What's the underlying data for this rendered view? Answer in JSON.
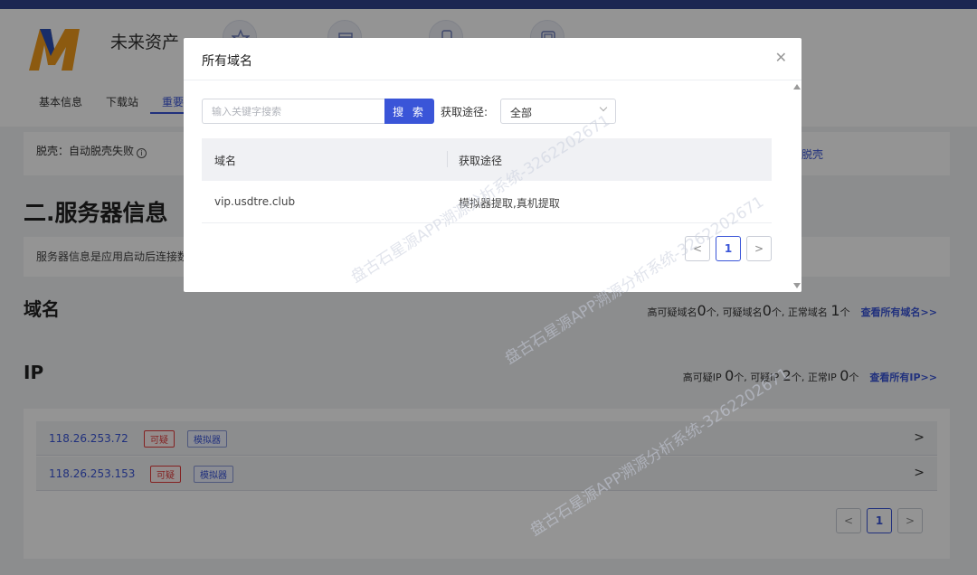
{
  "header": {
    "app_name": "未来资产",
    "tabs": [
      "基本信息",
      "下载站",
      "重要"
    ]
  },
  "shelling": {
    "label": "脱壳：自动脱壳失败",
    "info_glyph": "i",
    "action_label": "脱壳"
  },
  "server": {
    "section_title": "二.服务器信息",
    "description": "服务器信息是应用启动后连接数"
  },
  "domains": {
    "title": "域名",
    "high_label": "高可疑域名",
    "high_count": "0",
    "mid_label": "个, 可疑域名",
    "mid_count": "0",
    "normal_label": "个, 正常域名 ",
    "normal_count": "1",
    "unit": "个",
    "view_all": "查看所有域名>>"
  },
  "ips": {
    "title": "IP",
    "high_label": "高可疑IP ",
    "high_count": "0",
    "mid_label": "个, 可疑IP ",
    "mid_count": "2",
    "normal_label": "个, 正常IP ",
    "normal_count": "0",
    "unit": "个",
    "view_all": "查看所有IP>>",
    "rows": [
      {
        "address": "118.26.253.72",
        "tag_suspicious": "可疑",
        "tag_emulator": "模拟器"
      },
      {
        "address": "118.26.253.153",
        "tag_suspicious": "可疑",
        "tag_emulator": "模拟器"
      }
    ],
    "page": "1"
  },
  "modal": {
    "title": "所有域名",
    "close_glyph": "✕",
    "search_placeholder": "输入关键字搜索",
    "search_button": "搜 索",
    "filter_label": "获取途径:",
    "filter_value": "全部",
    "columns": [
      "域名",
      "获取途径"
    ],
    "rows": [
      {
        "domain": "vip.usdtre.club",
        "source": "模拟器提取,真机提取"
      }
    ],
    "page": "1"
  },
  "pager": {
    "prev": "<",
    "next": ">"
  },
  "watermark_text": "盘古石星源APP溯源分析系统-3262202671",
  "colors": {
    "accent": "#3a55d8",
    "danger": "#e23b3b",
    "topbar": "#1c2652",
    "logo_orange": "#f29b1d",
    "logo_blue": "#2a4fb5"
  }
}
